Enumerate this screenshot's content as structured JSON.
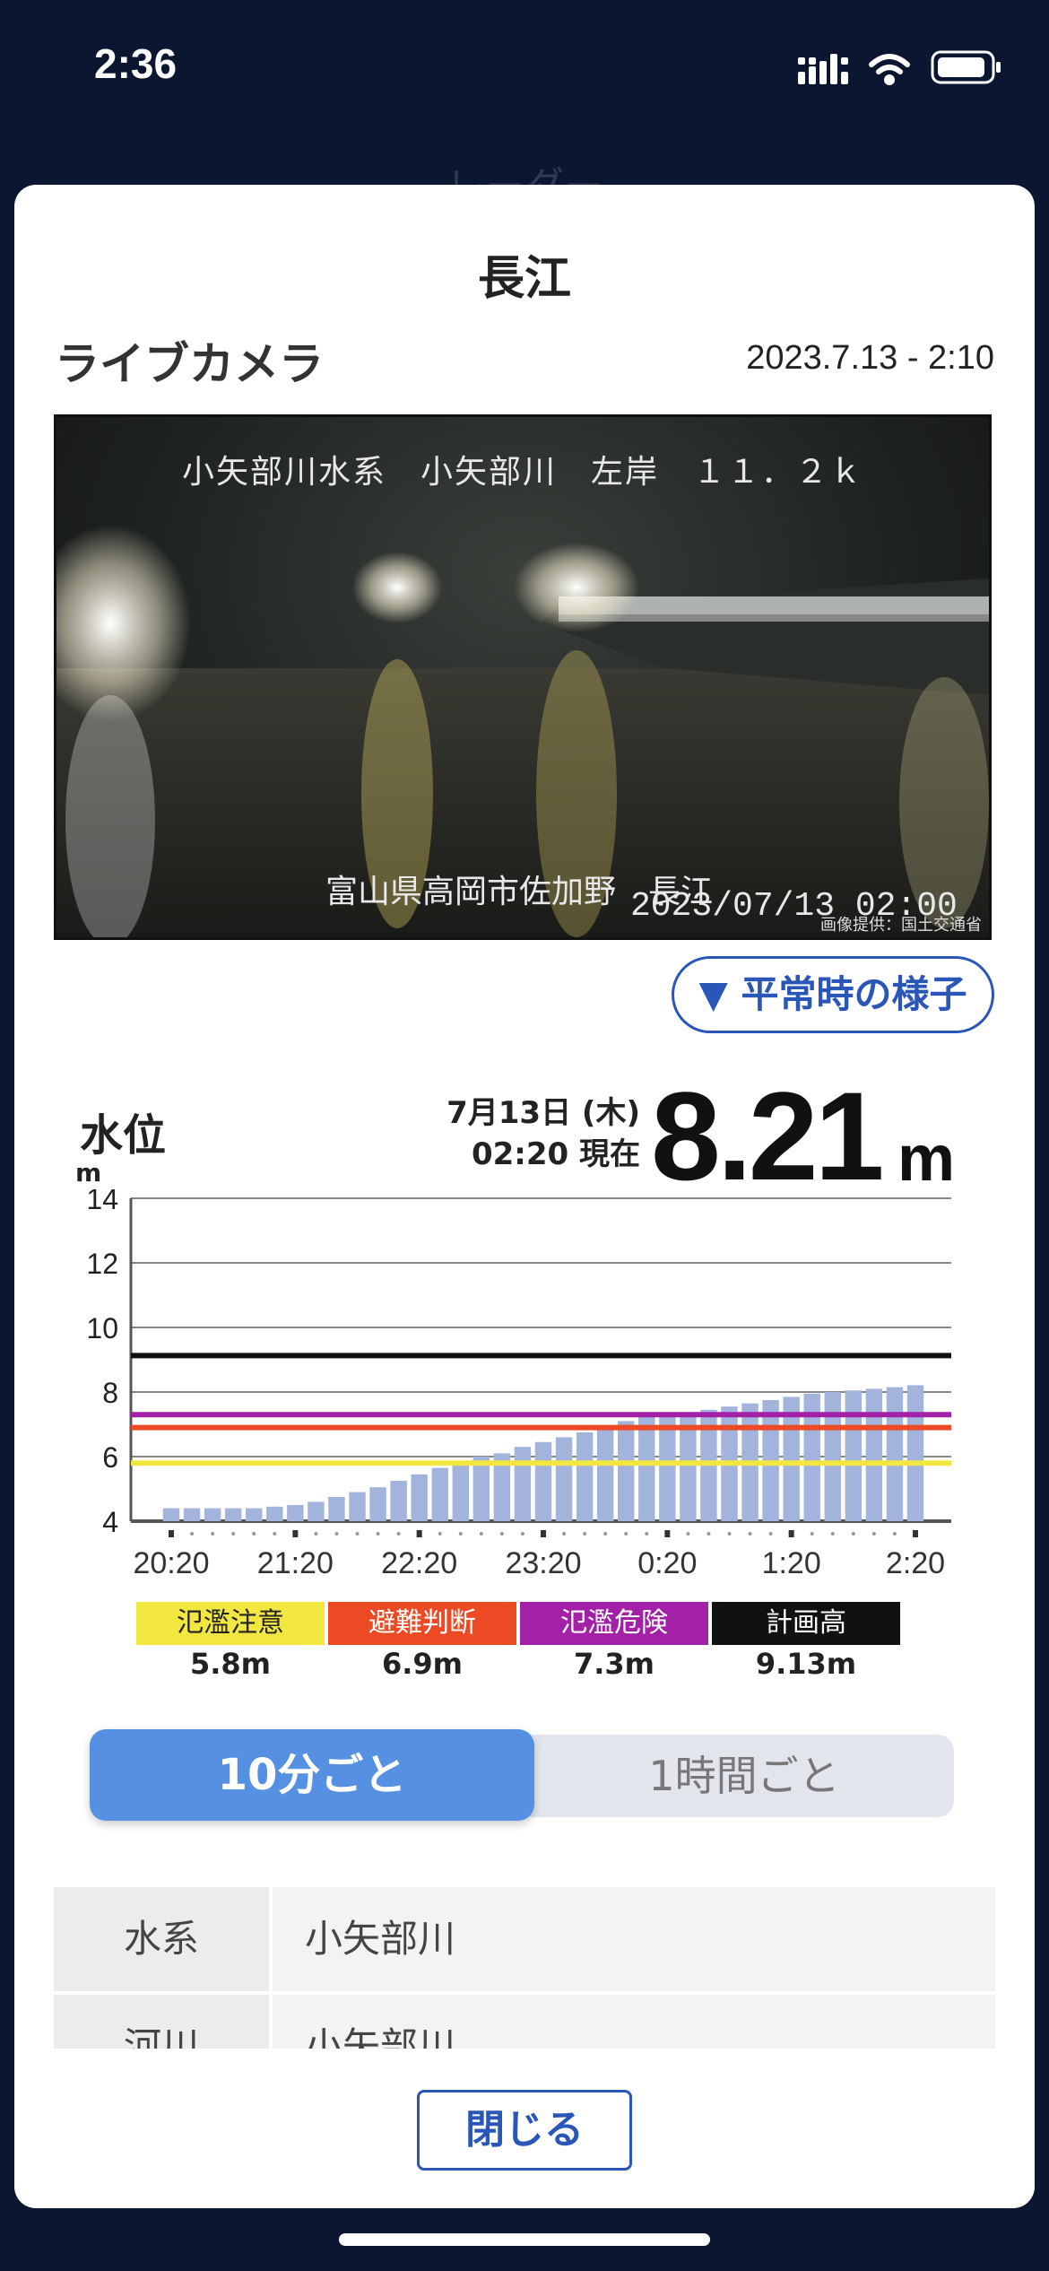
{
  "status_bar": {
    "time": "2:36"
  },
  "background": {
    "title": "レーダー"
  },
  "modal": {
    "title": "長江",
    "live_camera": {
      "label": "ライブカメラ",
      "timestamp": "2023.7.13 - 2:10",
      "overlay_top": "小矢部川水系　小矢部川　左岸　１１．２ｋ",
      "overlay_bottom": "富山県高岡市佐加野　長江",
      "overlay_date": "2023/07/13 02:00",
      "credit": "画像提供：国土交通省"
    },
    "normal_button": "▼ 平常時の様子",
    "water_level": {
      "title": "水位",
      "unit_label": "m",
      "date": "7月13日 (木)",
      "time": "02:20 現在",
      "value": "8.21",
      "unit": "m"
    },
    "legend": [
      {
        "label": "氾濫注意",
        "value": "5.8m",
        "color": "#f2e640",
        "text_color": "#222"
      },
      {
        "label": "避難判断",
        "value": "6.9m",
        "color": "#eb4a25",
        "text_color": "#fff"
      },
      {
        "label": "氾濫危険",
        "value": "7.3m",
        "color": "#a321a6",
        "text_color": "#fff"
      },
      {
        "label": "計画高",
        "value": "9.13m",
        "color": "#111111",
        "text_color": "#fff"
      }
    ],
    "toggle": {
      "option_10min": "10分ごと",
      "option_1hour": "1時間ごと",
      "selected": "10分ごと"
    },
    "info_table": [
      {
        "key": "水系",
        "value": "小矢部川"
      },
      {
        "key": "河川",
        "value": "小矢部川"
      }
    ],
    "close_button": "閉じる"
  },
  "chart_data": {
    "type": "bar",
    "ylabel": "m",
    "ylim": [
      4,
      14
    ],
    "yticks": [
      4,
      6,
      8,
      10,
      12,
      14
    ],
    "xtick_labels": [
      "20:20",
      "21:20",
      "22:20",
      "23:20",
      "0:20",
      "1:20",
      "2:20"
    ],
    "categories": [
      "20:20",
      "20:30",
      "20:40",
      "20:50",
      "21:00",
      "21:10",
      "21:20",
      "21:30",
      "21:40",
      "21:50",
      "22:00",
      "22:10",
      "22:20",
      "22:30",
      "22:40",
      "22:50",
      "23:00",
      "23:10",
      "23:20",
      "23:30",
      "23:40",
      "23:50",
      "0:00",
      "0:10",
      "0:20",
      "0:30",
      "0:40",
      "0:50",
      "1:00",
      "1:10",
      "1:20",
      "1:30",
      "1:40",
      "1:50",
      "2:00",
      "2:10",
      "2:20"
    ],
    "values": [
      4.4,
      4.4,
      4.4,
      4.4,
      4.4,
      4.45,
      4.5,
      4.6,
      4.75,
      4.9,
      5.05,
      5.25,
      5.45,
      5.65,
      5.85,
      6.0,
      6.1,
      6.3,
      6.45,
      6.6,
      6.75,
      6.95,
      7.1,
      7.25,
      7.3,
      7.35,
      7.45,
      7.55,
      7.65,
      7.75,
      7.85,
      7.95,
      8.0,
      8.05,
      8.1,
      8.15,
      8.21
    ],
    "thresholds": [
      {
        "name": "氾濫注意",
        "value": 5.8,
        "color": "#f2e640"
      },
      {
        "name": "避難判断",
        "value": 6.9,
        "color": "#eb4a25"
      },
      {
        "name": "氾濫危険",
        "value": 7.3,
        "color": "#a321a6"
      },
      {
        "name": "計画高",
        "value": 9.13,
        "color": "#111111"
      }
    ],
    "bar_color": "#a3b4dc",
    "grid": true
  }
}
